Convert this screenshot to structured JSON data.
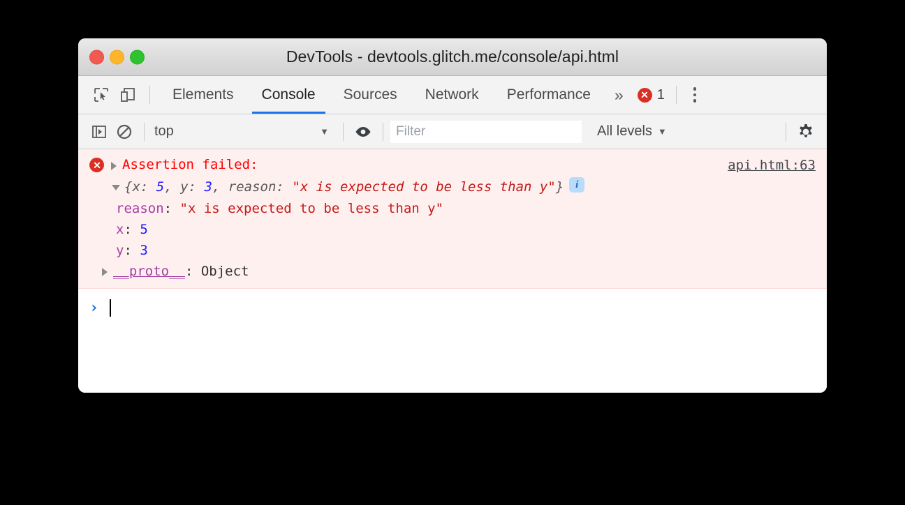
{
  "window": {
    "title": "DevTools - devtools.glitch.me/console/api.html",
    "traffic_lights": [
      "close",
      "minimize",
      "zoom"
    ]
  },
  "tabbar": {
    "inspect_icon": "inspect-element-icon",
    "device_icon": "device-toolbar-icon",
    "tabs": [
      {
        "label": "Elements",
        "active": false
      },
      {
        "label": "Console",
        "active": true
      },
      {
        "label": "Sources",
        "active": false
      },
      {
        "label": "Network",
        "active": false
      },
      {
        "label": "Performance",
        "active": false
      }
    ],
    "more_tabs": "»",
    "error_count": "1",
    "menu_icon": "kebab-menu-icon"
  },
  "console_toolbar": {
    "sidebar_icon": "show-console-sidebar-icon",
    "clear_icon": "clear-console-icon",
    "context": "top",
    "context_caret": "▼",
    "eye_icon": "live-expression-eye-icon",
    "filter": {
      "value": "",
      "placeholder": "Filter"
    },
    "levels": "All levels",
    "levels_caret": "▼",
    "settings_icon": "settings-gear-icon"
  },
  "console": {
    "error_message": {
      "icon": "error-icon",
      "collapse_triangle": "▶",
      "text": "Assertion failed:",
      "source": "api.html:63"
    },
    "object_preview": {
      "expand_triangle": "▼",
      "open_brace": "{",
      "key_x": "x: ",
      "val_x": "5",
      "sep1": ", ",
      "key_y": "y: ",
      "val_y": "3",
      "sep2": ", ",
      "key_reason": "reason: ",
      "val_reason": "\"x is expected to be less than y\"",
      "close_brace": "}",
      "info_badge": "i"
    },
    "properties": [
      {
        "name": "reason",
        "sep": ": ",
        "value": "\"x is expected to be less than y\"",
        "kind": "string"
      },
      {
        "name": "x",
        "sep": ": ",
        "value": "5",
        "kind": "number"
      },
      {
        "name": "y",
        "sep": ": ",
        "value": "3",
        "kind": "number"
      },
      {
        "name": "__proto__",
        "sep": ": ",
        "value": "Object",
        "kind": "object"
      }
    ],
    "proto_triangle": "▶",
    "prompt": {
      "chevron": "›",
      "value": ""
    }
  },
  "colors": {
    "error_red": "#ff0000",
    "string_red": "#c41a16",
    "number_blue": "#1a1aff",
    "property_purple": "#a33ea3",
    "error_bg": "#fff0f0",
    "accent_blue": "#1a73e8",
    "error_icon": "#d93025"
  }
}
